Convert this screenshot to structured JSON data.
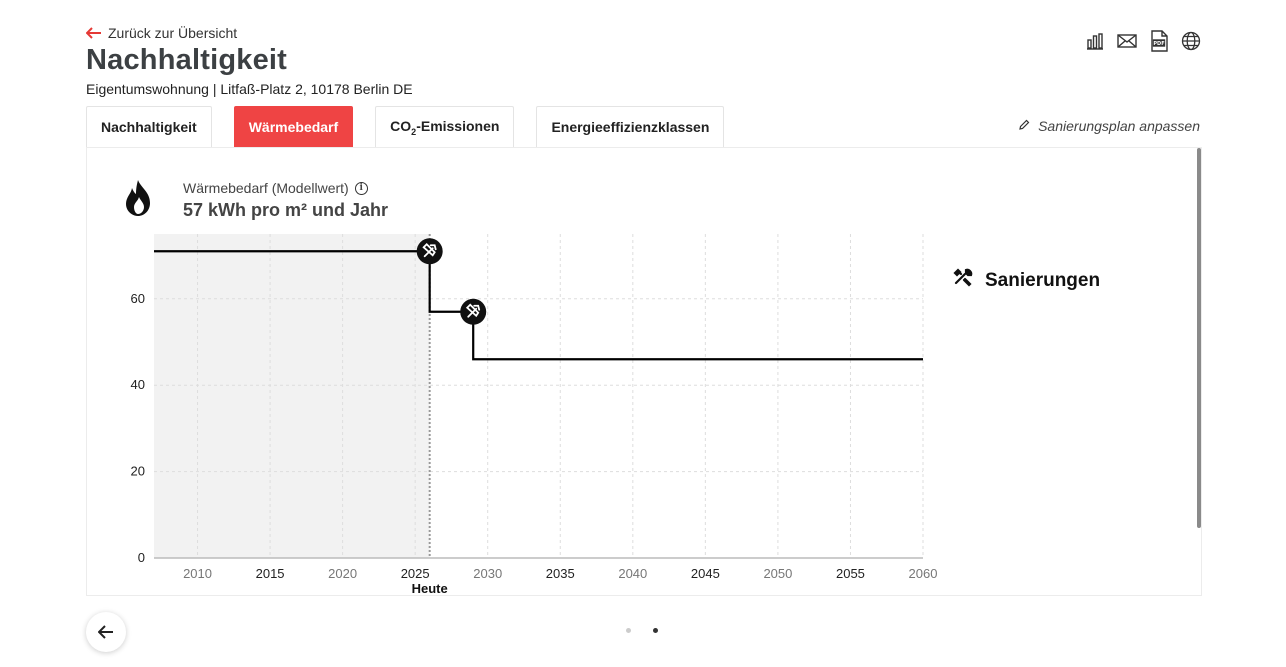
{
  "header": {
    "back_label": "Zurück zur Übersicht",
    "title": "Nachhaltigkeit",
    "subtitle": "Eigentumswohnung | Litfaß-Platz 2, 10178 Berlin DE"
  },
  "top_icons": [
    "bar-chart-icon",
    "mail-icon",
    "pdf-icon",
    "globe-icon"
  ],
  "tabs": [
    {
      "label": "Nachhaltigkeit",
      "active": false
    },
    {
      "label": "Wärmebedarf",
      "active": true
    },
    {
      "label_pre": "CO",
      "label_sub": "2",
      "label_post": "-Emissionen",
      "active": false
    },
    {
      "label": "Energieeffizienzklassen",
      "active": false
    }
  ],
  "edit_plan_label": "Sanierungsplan anpassen",
  "metric": {
    "label": "Wärmebedarf (Modellwert)",
    "value": "57 kWh pro m² und Jahr"
  },
  "legend_label": "Sanierungen",
  "today_label": "Heute",
  "colors": {
    "accent": "#ef4444",
    "past_shade": "#f2f2f2",
    "line": "#000000"
  },
  "chart_data": {
    "type": "line",
    "step": true,
    "x": [
      2007,
      2026,
      2026,
      2029,
      2029,
      2060
    ],
    "y": [
      71,
      71,
      57,
      57,
      46,
      46
    ],
    "renovations": [
      {
        "x": 2026,
        "y": 71
      },
      {
        "x": 2029,
        "y": 57
      }
    ],
    "today": 2026,
    "xlim": [
      2007,
      2060
    ],
    "ylim": [
      0,
      75
    ],
    "xticks": [
      2010,
      2015,
      2020,
      2025,
      2030,
      2035,
      2040,
      2045,
      2050,
      2055,
      2060
    ],
    "yticks": [
      0,
      20,
      40,
      60
    ],
    "grid": true
  }
}
